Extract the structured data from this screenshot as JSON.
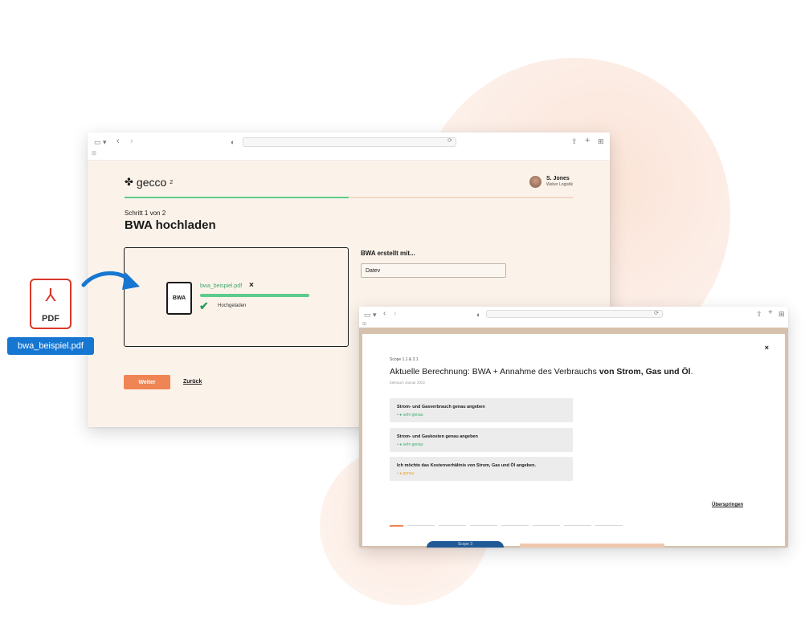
{
  "pdf": {
    "icon": "acrobat-icon",
    "label": "PDF",
    "filename": "bwa_beispiel.pdf"
  },
  "window1": {
    "brand": {
      "name": "gecco",
      "sub": "2"
    },
    "user": {
      "name": "S. Jones",
      "company": "Weber Logistik"
    },
    "progress": 0.5,
    "step": "Schritt 1 von 2",
    "title": "BWA hochladen",
    "upload": {
      "doc_label": "BWA",
      "filename": "bwa_beispiel.pdf",
      "close": "×",
      "status": "Hochgeladen"
    },
    "side_label": "BWA erstellt mit...",
    "side_value": "Datev",
    "next": "Weiter",
    "back": "Zurück"
  },
  "window2": {
    "close": "×",
    "scope": "Scope 1.1 & 2.1",
    "title_plain": "Aktuelle Berechnung: BWA + Annahme des Verbrauchs ",
    "title_bold": "von Strom, Gas und Öl",
    "title_end": ".",
    "subtitle": "Zeitraum Januar 2022",
    "options": [
      {
        "title": "Strom- und Gasverbrauch genau angeben",
        "quality": "sehr genau",
        "color": "#3fae72"
      },
      {
        "title": "Strom- und Gaskosten genau angeben",
        "quality": "sehr genau",
        "color": "#3fae72"
      },
      {
        "title": "Ich möchte das Kostenverhältnis von Strom, Gas und Öl angeben.",
        "quality": "genau",
        "color": "#e6a336"
      }
    ],
    "skip": "Überspringen",
    "peek": "Scope 3"
  }
}
